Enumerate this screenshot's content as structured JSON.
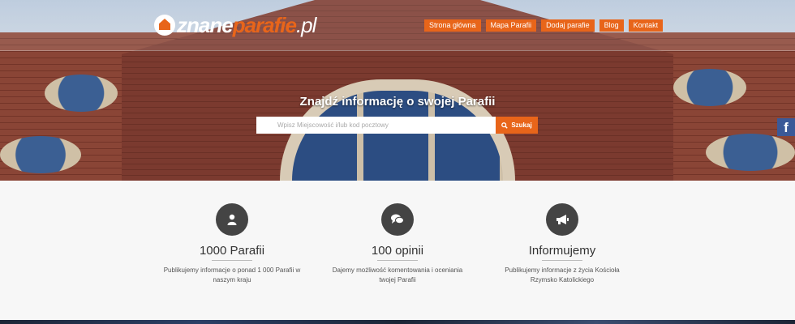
{
  "logo": {
    "part1": "znane",
    "part2": "parafie",
    "part3": ".pl"
  },
  "nav": [
    {
      "label": "Strona główna"
    },
    {
      "label": "Mapa Parafii"
    },
    {
      "label": "Dodaj parafie"
    },
    {
      "label": "Blog"
    },
    {
      "label": "Kontakt"
    }
  ],
  "hero": {
    "title": "Znajdź informację o swojej Parafii",
    "search_placeholder": "Wpisz Miejscowość i/lub kod pocztowy",
    "search_button": "Szukaj"
  },
  "social": {
    "facebook": "f"
  },
  "features": [
    {
      "title": "1000 Parafii",
      "desc": "Publikujemy informacje o ponad 1 000 Parafii w naszym kraju",
      "icon": "user-icon"
    },
    {
      "title": "100 opinii",
      "desc": "Dajemy możliwość komentowania i oceniania twojej Parafii",
      "icon": "comments-icon"
    },
    {
      "title": "Informujemy",
      "desc": "Publikujemy informacje z życia Kościoła Rzymsko Katolickiego",
      "icon": "bullhorn-icon"
    }
  ],
  "colors": {
    "accent": "#e8651a",
    "icon_bg": "#444444",
    "facebook": "#3b5998"
  }
}
